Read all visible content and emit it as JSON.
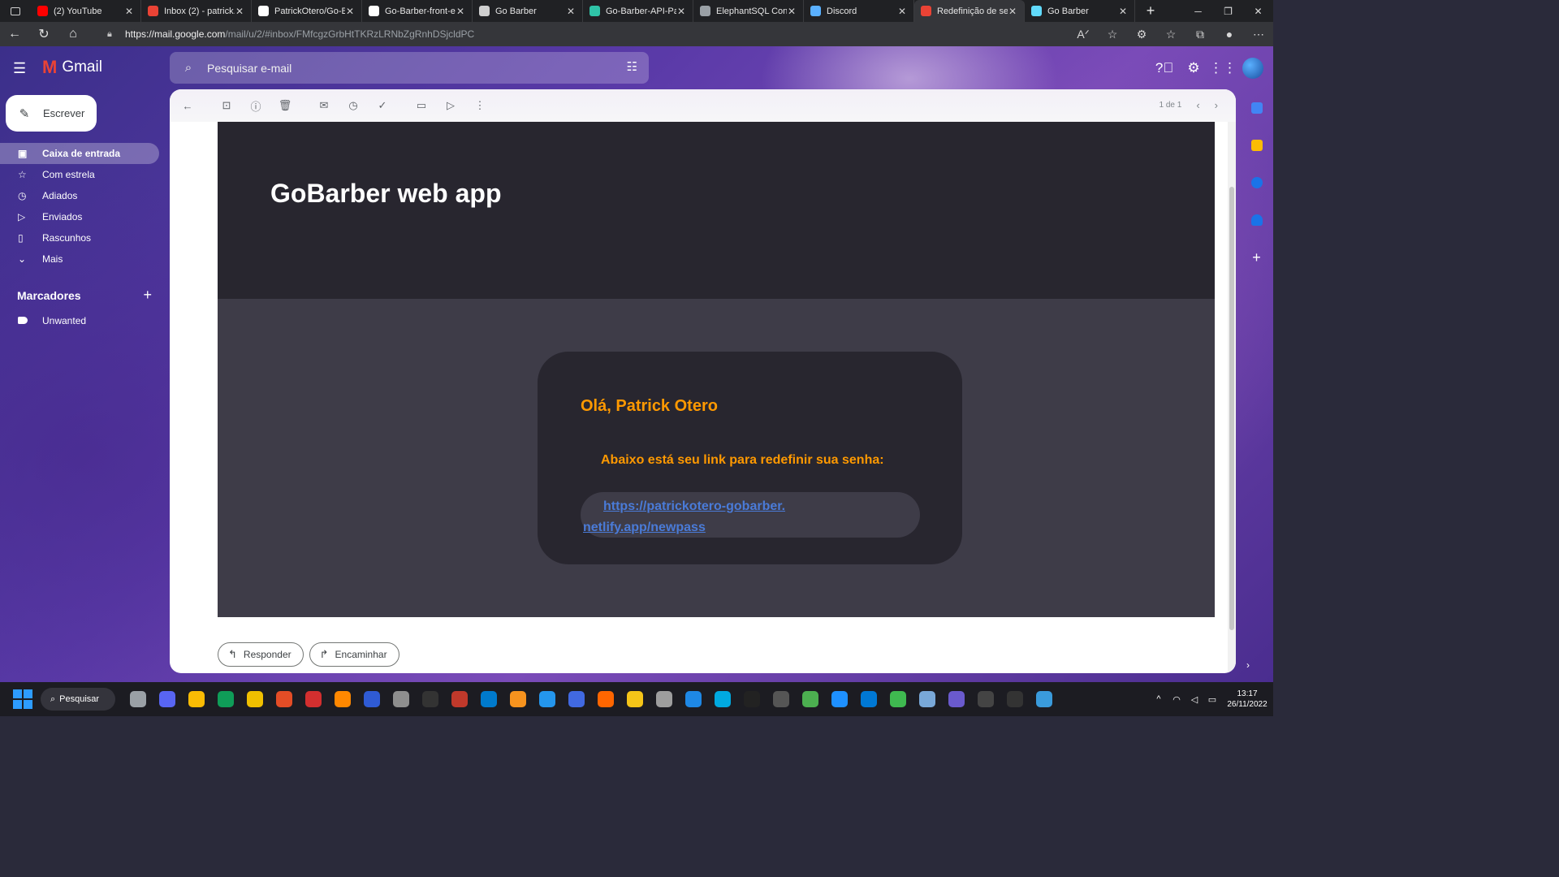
{
  "browser": {
    "tabs": [
      {
        "title": "(2) YouTube",
        "favicon": "youtube-icon",
        "color": "#ff0000"
      },
      {
        "title": "Inbox (2) - patrick.",
        "favicon": "gmail-icon",
        "color": "#ea4335"
      },
      {
        "title": "PatrickOtero/Go-B",
        "favicon": "github-icon",
        "color": "#ffffff"
      },
      {
        "title": "Go-Barber-front-e",
        "favicon": "github-icon",
        "color": "#ffffff"
      },
      {
        "title": "Go Barber",
        "favicon": "page-icon",
        "color": "#cfcfcf"
      },
      {
        "title": "Go-Barber-API-Pat",
        "favicon": "netlify-icon",
        "color": "#2fc4a8"
      },
      {
        "title": "ElephantSQL Cons",
        "favicon": "elephant-icon",
        "color": "#9aa0a6"
      },
      {
        "title": "Discord",
        "favicon": "loading-icon",
        "color": "#5ab0ff"
      },
      {
        "title": "Redefinição de sen",
        "favicon": "gmail-icon",
        "color": "#ea4335"
      },
      {
        "title": "Go Barber",
        "favicon": "react-icon",
        "color": "#61dafb"
      }
    ],
    "url_host": "https://mail.google.com",
    "url_path": "/mail/u/2/#inbox/FMfcgzGrbHtTKRzLRNbZgRnhDSjcldPC"
  },
  "gmail": {
    "logo_text": "Gmail",
    "search_placeholder": "Pesquisar e-mail",
    "compose_label": "Escrever",
    "nav": [
      {
        "label": "Caixa de entrada",
        "icon": "inbox-icon",
        "glyph": "▣",
        "active": true
      },
      {
        "label": "Com estrela",
        "icon": "star-icon",
        "glyph": "☆",
        "active": false
      },
      {
        "label": "Adiados",
        "icon": "clock-icon",
        "glyph": "◷",
        "active": false
      },
      {
        "label": "Enviados",
        "icon": "send-icon",
        "glyph": "▷",
        "active": false
      },
      {
        "label": "Rascunhos",
        "icon": "draft-icon",
        "glyph": "▯",
        "active": false
      },
      {
        "label": "Mais",
        "icon": "chevron-down-icon",
        "glyph": "⌄",
        "active": false
      }
    ],
    "labels_title": "Marcadores",
    "labels": [
      {
        "label": "Unwanted"
      }
    ],
    "pager_text": "1 de 1"
  },
  "email": {
    "header_title": "GoBarber web app",
    "greeting": "Olá, Patrick Otero",
    "message": "Abaixo está seu link para redefinir sua senha:",
    "link_line1": "https://patrickotero-gobarber.",
    "link_line2": "netlify.app/newpass",
    "accent": "#ff9900"
  },
  "actions": {
    "reply_label": "Responder",
    "forward_label": "Encaminhar"
  },
  "taskbar": {
    "search_label": "Pesquisar",
    "time": "13:17",
    "date": "26/11/2022",
    "apps": [
      "#9aa0a6",
      "#5865f2",
      "#fbbc04",
      "#0f9d58",
      "#f0c000",
      "#e44d26",
      "#d32f2f",
      "#ff8800",
      "#2f5bd4",
      "#8e8e8e",
      "#333333",
      "#c0392b",
      "#007acc",
      "#f7931e",
      "#2496ed",
      "#4169e1",
      "#ff6600",
      "#f5c518",
      "#9e9e9e",
      "#1e88e5",
      "#00a9e0",
      "#222222",
      "#555555",
      "#4caf50",
      "#1e90ff",
      "#0078d4",
      "#3fb950",
      "#79a8d8",
      "#6a5acd",
      "#444444",
      "#333333",
      "#3a9bdc"
    ]
  }
}
